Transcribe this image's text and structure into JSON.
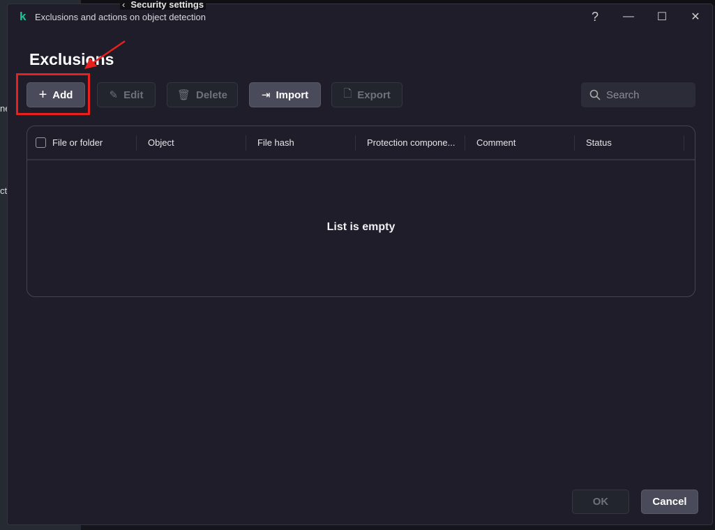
{
  "background": {
    "top_text": "Security settings",
    "left_text_1": "ne",
    "left_text_2": "ct"
  },
  "window": {
    "logo": "k",
    "title": "Exclusions and actions on object detection",
    "help": "?",
    "minimize": "—",
    "maximize": "☐",
    "close": "✕"
  },
  "page_title": "Exclusions",
  "toolbar": {
    "add": "Add",
    "edit": "Edit",
    "delete": "Delete",
    "import": "Import",
    "export": "Export",
    "search_placeholder": "Search"
  },
  "table": {
    "columns": [
      "File or folder",
      "Object",
      "File hash",
      "Protection compone...",
      "Comment",
      "Status"
    ],
    "empty_text": "List is empty"
  },
  "footer": {
    "ok": "OK",
    "cancel": "Cancel"
  },
  "colors": {
    "accent": "#1fc39b",
    "annotation": "#e8211f"
  }
}
